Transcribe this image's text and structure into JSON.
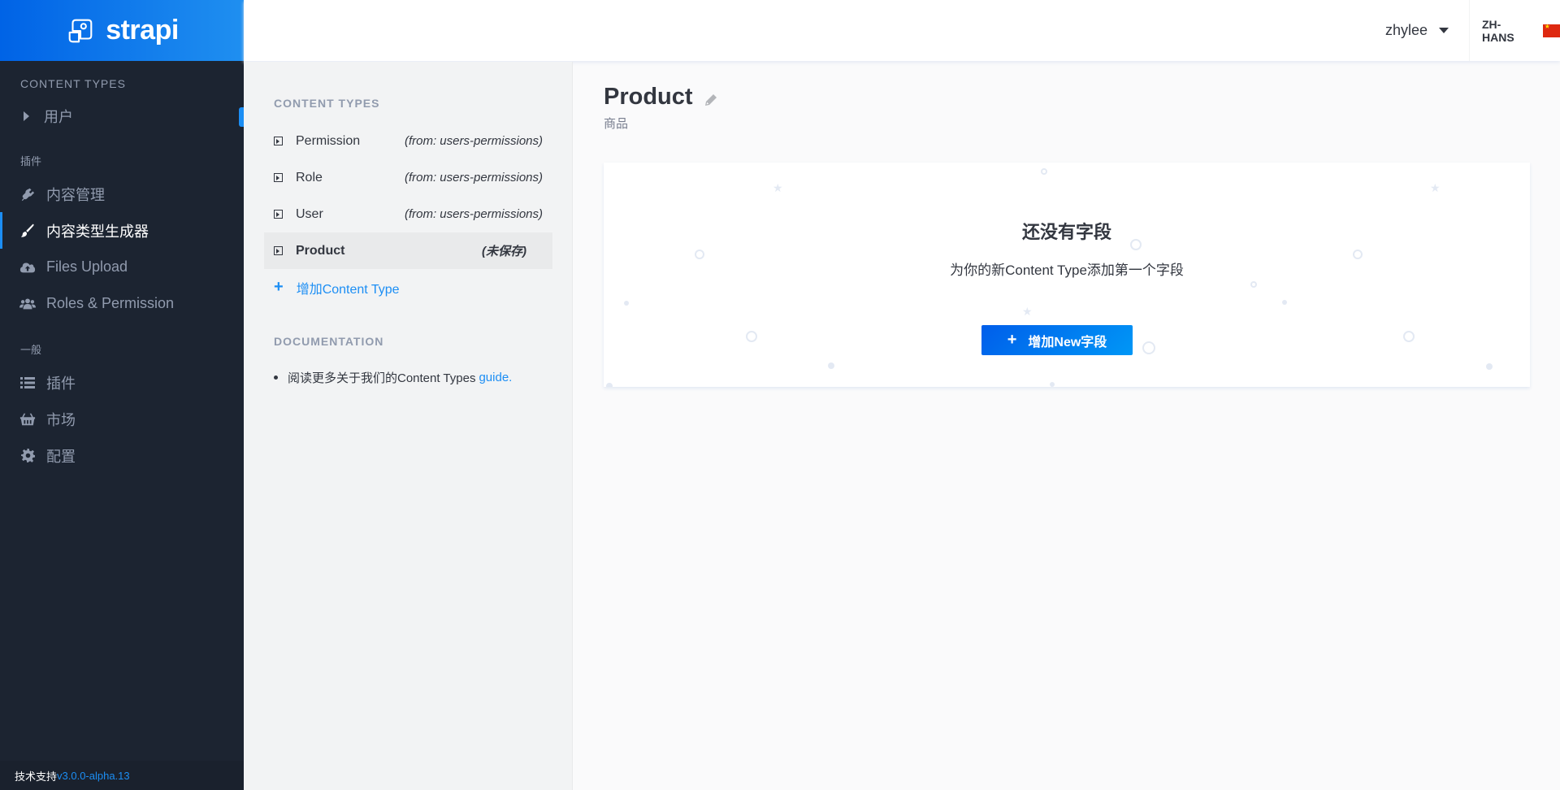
{
  "brand": {
    "name": "strapi"
  },
  "sidebar": {
    "section_content_types": "Content Types",
    "content_types": [
      {
        "label": "用户"
      }
    ],
    "section_plugins": "插件",
    "plugins": [
      {
        "label": "内容管理",
        "icon": "plug-icon"
      },
      {
        "label": "内容类型生成器",
        "icon": "paint-brush-icon",
        "active": true
      },
      {
        "label": "Files Upload",
        "icon": "cloud-upload-icon"
      },
      {
        "label": "Roles & Permission",
        "icon": "users-icon"
      }
    ],
    "section_general": "一般",
    "general": [
      {
        "label": "插件",
        "icon": "list-icon"
      },
      {
        "label": "市场",
        "icon": "shopping-basket-icon"
      },
      {
        "label": "配置",
        "icon": "gear-icon"
      }
    ],
    "footer": {
      "prefix": "技术支持",
      "version": "v3.0.0-alpha.13"
    }
  },
  "header": {
    "username": "zhylee",
    "locale": "ZH-HANS",
    "flag_icon": "china-flag-icon"
  },
  "content_type_panel": {
    "title": "Content Types",
    "items": [
      {
        "name": "Permission",
        "source": "(from: users-permissions)"
      },
      {
        "name": "Role",
        "source": "(from: users-permissions)"
      },
      {
        "name": "User",
        "source": "(from: users-permissions)"
      },
      {
        "name": "Product",
        "source": "(未保存)",
        "active": true
      }
    ],
    "add_label": "增加Content Type",
    "doc_title": "Documentation",
    "doc_text": "阅读更多关于我们的Content Types",
    "doc_link": "guide."
  },
  "main": {
    "title": "Product",
    "subtitle": "商品",
    "empty_title": "还没有字段",
    "empty_desc": "为你的新Content Type添加第一个字段",
    "add_field_label": "增加New字段"
  },
  "colors": {
    "sidebar_bg": "#1c2431",
    "brand_gradient_start": "#0063e6",
    "accent": "#1c8ef4",
    "button_gradient_end": "#005eea"
  }
}
